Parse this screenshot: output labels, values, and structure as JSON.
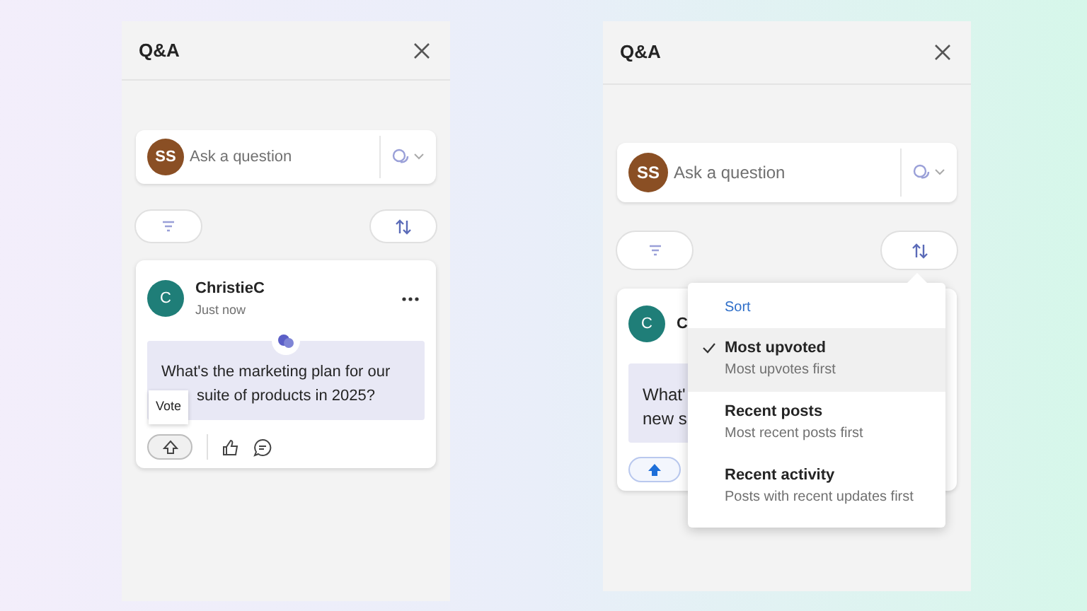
{
  "panels": [
    {
      "title": "Q&A",
      "ask": {
        "avatar": "SS",
        "placeholder": "Ask a question"
      },
      "post": {
        "avatar": "C",
        "author": "ChristieC",
        "time": "Just now",
        "question_lines": [
          "What's the marketing plan for our",
          "suite of products in 2025?"
        ],
        "tooltip": "Vote",
        "voted": false
      }
    },
    {
      "title": "Q&A",
      "ask": {
        "avatar": "SS",
        "placeholder": "Ask a question"
      },
      "post": {
        "avatar": "C",
        "author": "C",
        "question_lines": [
          "What'",
          "new s"
        ],
        "voted": true
      },
      "sort_menu": {
        "heading": "Sort",
        "options": [
          {
            "label": "Most upvoted",
            "description": "Most upvotes first",
            "selected": true
          },
          {
            "label": "Recent posts",
            "description": "Most recent posts first",
            "selected": false
          },
          {
            "label": "Recent activity",
            "description": "Posts with recent updates first",
            "selected": false
          }
        ]
      }
    }
  ]
}
